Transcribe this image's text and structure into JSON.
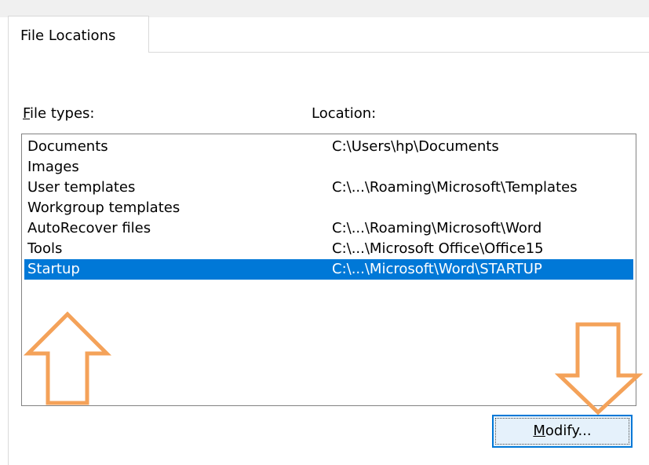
{
  "dialog": {
    "tabs": [
      {
        "label": "File Locations",
        "active": true
      }
    ]
  },
  "columns": {
    "file_types_label": "File types:",
    "file_types_accesskey": "F",
    "file_types_rest": "ile types:",
    "location_label": "Location:"
  },
  "rows": [
    {
      "type": "Documents",
      "location": "C:\\Users\\hp\\Documents",
      "selected": false
    },
    {
      "type": "Images",
      "location": "",
      "selected": false
    },
    {
      "type": "User templates",
      "location": "C:\\...\\Roaming\\Microsoft\\Templates",
      "selected": false
    },
    {
      "type": "Workgroup templates",
      "location": "",
      "selected": false
    },
    {
      "type": "AutoRecover files",
      "location": "C:\\...\\Roaming\\Microsoft\\Word",
      "selected": false
    },
    {
      "type": "Tools",
      "location": "C:\\...\\Microsoft Office\\Office15",
      "selected": false
    },
    {
      "type": "Startup",
      "location": "C:\\...\\Microsoft\\Word\\STARTUP",
      "selected": true
    }
  ],
  "buttons": {
    "modify_label": "Modify...",
    "modify_accesskey": "M",
    "modify_rest": "odify..."
  },
  "annotations": {
    "arrow_color": "#f4a259",
    "arrows": [
      {
        "name": "up-arrow-icon",
        "direction": "up",
        "points_to": "Startup row"
      },
      {
        "name": "down-arrow-icon",
        "direction": "down",
        "points_to": "Modify button"
      }
    ]
  },
  "colors": {
    "selection": "#0078d7",
    "button_fill": "#e5f1fb",
    "button_border": "#0078d7",
    "list_border": "#828282"
  }
}
